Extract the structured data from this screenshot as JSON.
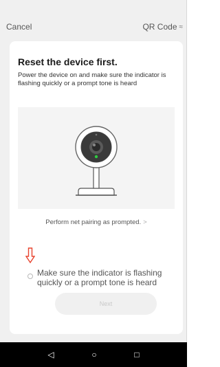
{
  "header": {
    "cancel_label": "Cancel",
    "qr_label": "QR Code",
    "qr_icon": "≈"
  },
  "card": {
    "title": "Reset the device first.",
    "description": "Power the device on and make sure the indicator is flashing quickly or a prompt tone is heard",
    "illustration": "security-camera-illustration",
    "pair_link_label": "Perform net pairing as prompted.",
    "pair_link_chevron": ">",
    "confirm_label": "Make sure the indicator is flashing quickly or a prompt tone is heard",
    "confirm_checked": false,
    "next_label": "Next",
    "next_enabled": false
  },
  "annotation": {
    "arrow_color": "#e8432e"
  },
  "navbar": {
    "back_icon": "◁",
    "home_icon": "○",
    "recents_icon": "□"
  }
}
